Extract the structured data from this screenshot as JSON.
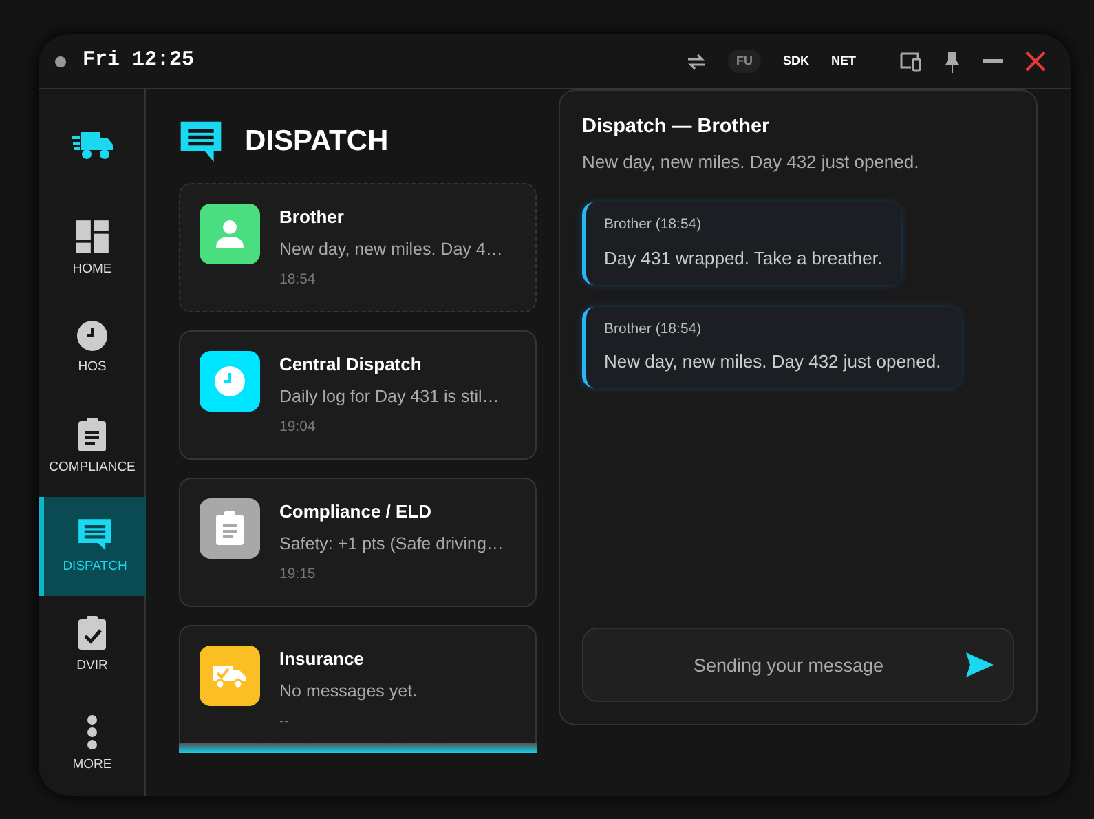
{
  "top_bar": {
    "time": "Fri 12:25",
    "badges": [
      {
        "label": "FU",
        "kind": "pill"
      },
      {
        "label": "SDK",
        "kind": "plain"
      },
      {
        "label": "NET",
        "kind": "plain"
      }
    ]
  },
  "sidebar": {
    "items": [
      {
        "label": "HOME",
        "kind": "dashboard",
        "selected": false
      },
      {
        "label": "HOS",
        "kind": "clock",
        "selected": false
      },
      {
        "label": "COMPLIANCE",
        "kind": "clipboard",
        "selected": false
      },
      {
        "label": "DISPATCH",
        "kind": "chat",
        "selected": true
      },
      {
        "label": "DVIR",
        "kind": "check",
        "selected": false
      },
      {
        "label": "MORE",
        "kind": "dots",
        "selected": false
      }
    ]
  },
  "page_title": "DISPATCH",
  "conversations": [
    {
      "name": "Brother",
      "preview": "New day, new miles. Day 4…",
      "time": "18:54",
      "kind": "person",
      "color": "#4ade80",
      "selected": true
    },
    {
      "name": "Central Dispatch",
      "preview": "Daily log for Day 431 is stil…",
      "time": "19:04",
      "kind": "clock",
      "color": "#00e5ff",
      "selected": false
    },
    {
      "name": "Compliance / ELD",
      "preview": "Safety: +1 pts (Safe driving…",
      "time": "19:15",
      "kind": "clipboard",
      "color": "#a8a8a8",
      "selected": false
    },
    {
      "name": "Insurance",
      "preview": "No messages yet.",
      "time": "--",
      "kind": "truck",
      "color": "#fbbf24",
      "selected": false
    }
  ],
  "chat": {
    "title": "Dispatch — Brother",
    "subtitle": "New day, new miles. Day 432 just opened.",
    "messages": [
      {
        "sender": "Brother (18:54)",
        "text": "Day 431 wrapped. Take a breather."
      },
      {
        "sender": "Brother (18:54)",
        "text": "New day, new miles. Day 432 just opened."
      }
    ],
    "input": {
      "placeholder": "Sending your message"
    }
  }
}
